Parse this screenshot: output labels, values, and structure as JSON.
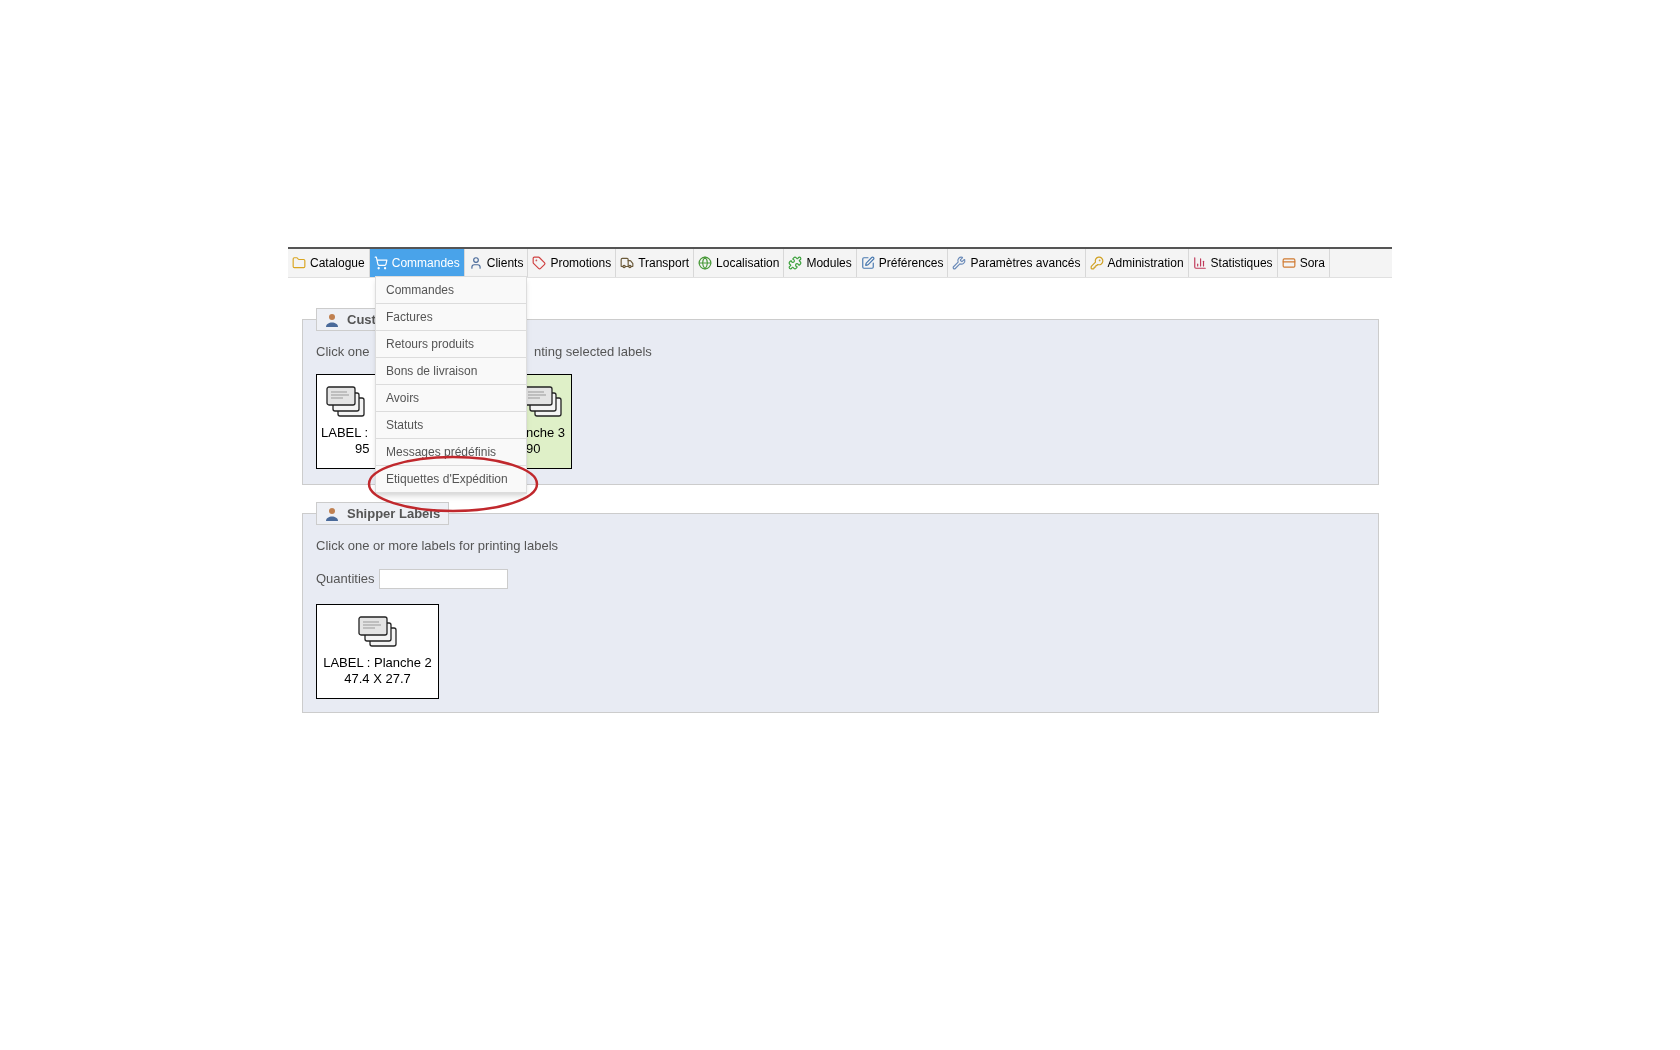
{
  "nav": {
    "tabs": [
      {
        "label": "Catalogue",
        "selected": false
      },
      {
        "label": "Commandes",
        "selected": true
      },
      {
        "label": "Clients",
        "selected": false
      },
      {
        "label": "Promotions",
        "selected": false
      },
      {
        "label": "Transport",
        "selected": false
      },
      {
        "label": "Localisation",
        "selected": false
      },
      {
        "label": "Modules",
        "selected": false
      },
      {
        "label": "Préférences",
        "selected": false
      },
      {
        "label": "Paramètres avancés",
        "selected": false
      },
      {
        "label": "Administration",
        "selected": false
      },
      {
        "label": "Statistiques",
        "selected": false
      },
      {
        "label": "Sora",
        "selected": false
      }
    ]
  },
  "dropdown": {
    "items": [
      "Commandes",
      "Factures",
      "Retours produits",
      "Bons de livraison",
      "Avoirs",
      "Statuts",
      "Messages prédéfinis",
      "Etiquettes d'Expédition"
    ]
  },
  "customer_panel": {
    "legend": "Cust",
    "instruction_left": "Click one",
    "instruction_right": "nting selected labels",
    "cards": [
      {
        "line_1": "LABEL :",
        "line_2": "95",
        "selected": false
      },
      {
        "line_1": "nche 3",
        "line_2": "90",
        "selected": true
      }
    ]
  },
  "shipper_panel": {
    "legend": "Shipper Labels",
    "instruction": "Click one or more labels for printing labels",
    "quantities_label": "Quantities",
    "cards": [
      {
        "line_1": "LABEL : Planche 2",
        "line_2": "47.4 X 27.7",
        "selected": false
      }
    ]
  }
}
